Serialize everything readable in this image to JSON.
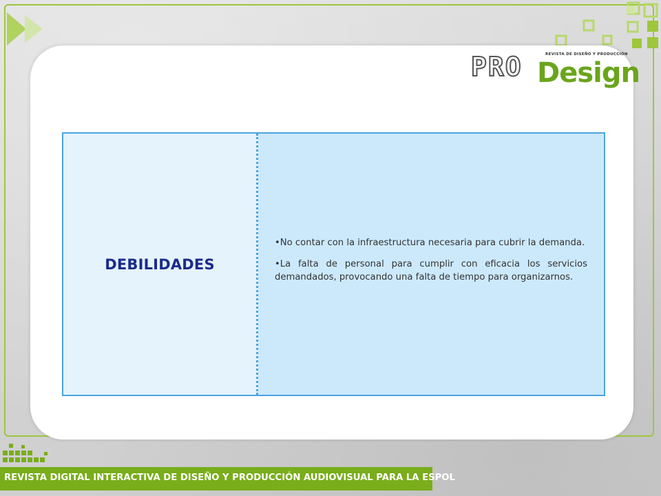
{
  "logo": {
    "pro": "PRO",
    "design": "Design",
    "subtitle": "REVISTA DE DISEÑO Y PRODUCCIÓN"
  },
  "table": {
    "heading": "DEBILIDADES",
    "bullets": [
      "•No contar con la infraestructura necesaria para cubrir la demanda.",
      "•La falta de personal para cumplir con eficacia los servicios demandados, provocando una falta de tiempo para organizarnos."
    ]
  },
  "footer": {
    "text": "REVISTA DIGITAL INTERACTIVA DE DISEÑO Y PRODUCCIÓN AUDIOVISUAL PARA LA ESPOL"
  },
  "colors": {
    "accent_green": "#79ad1a",
    "table_border": "#4aa3e0",
    "heading_blue": "#1a2b8c"
  },
  "icons": [
    "play-arrow-icon",
    "square-pattern-icon"
  ]
}
